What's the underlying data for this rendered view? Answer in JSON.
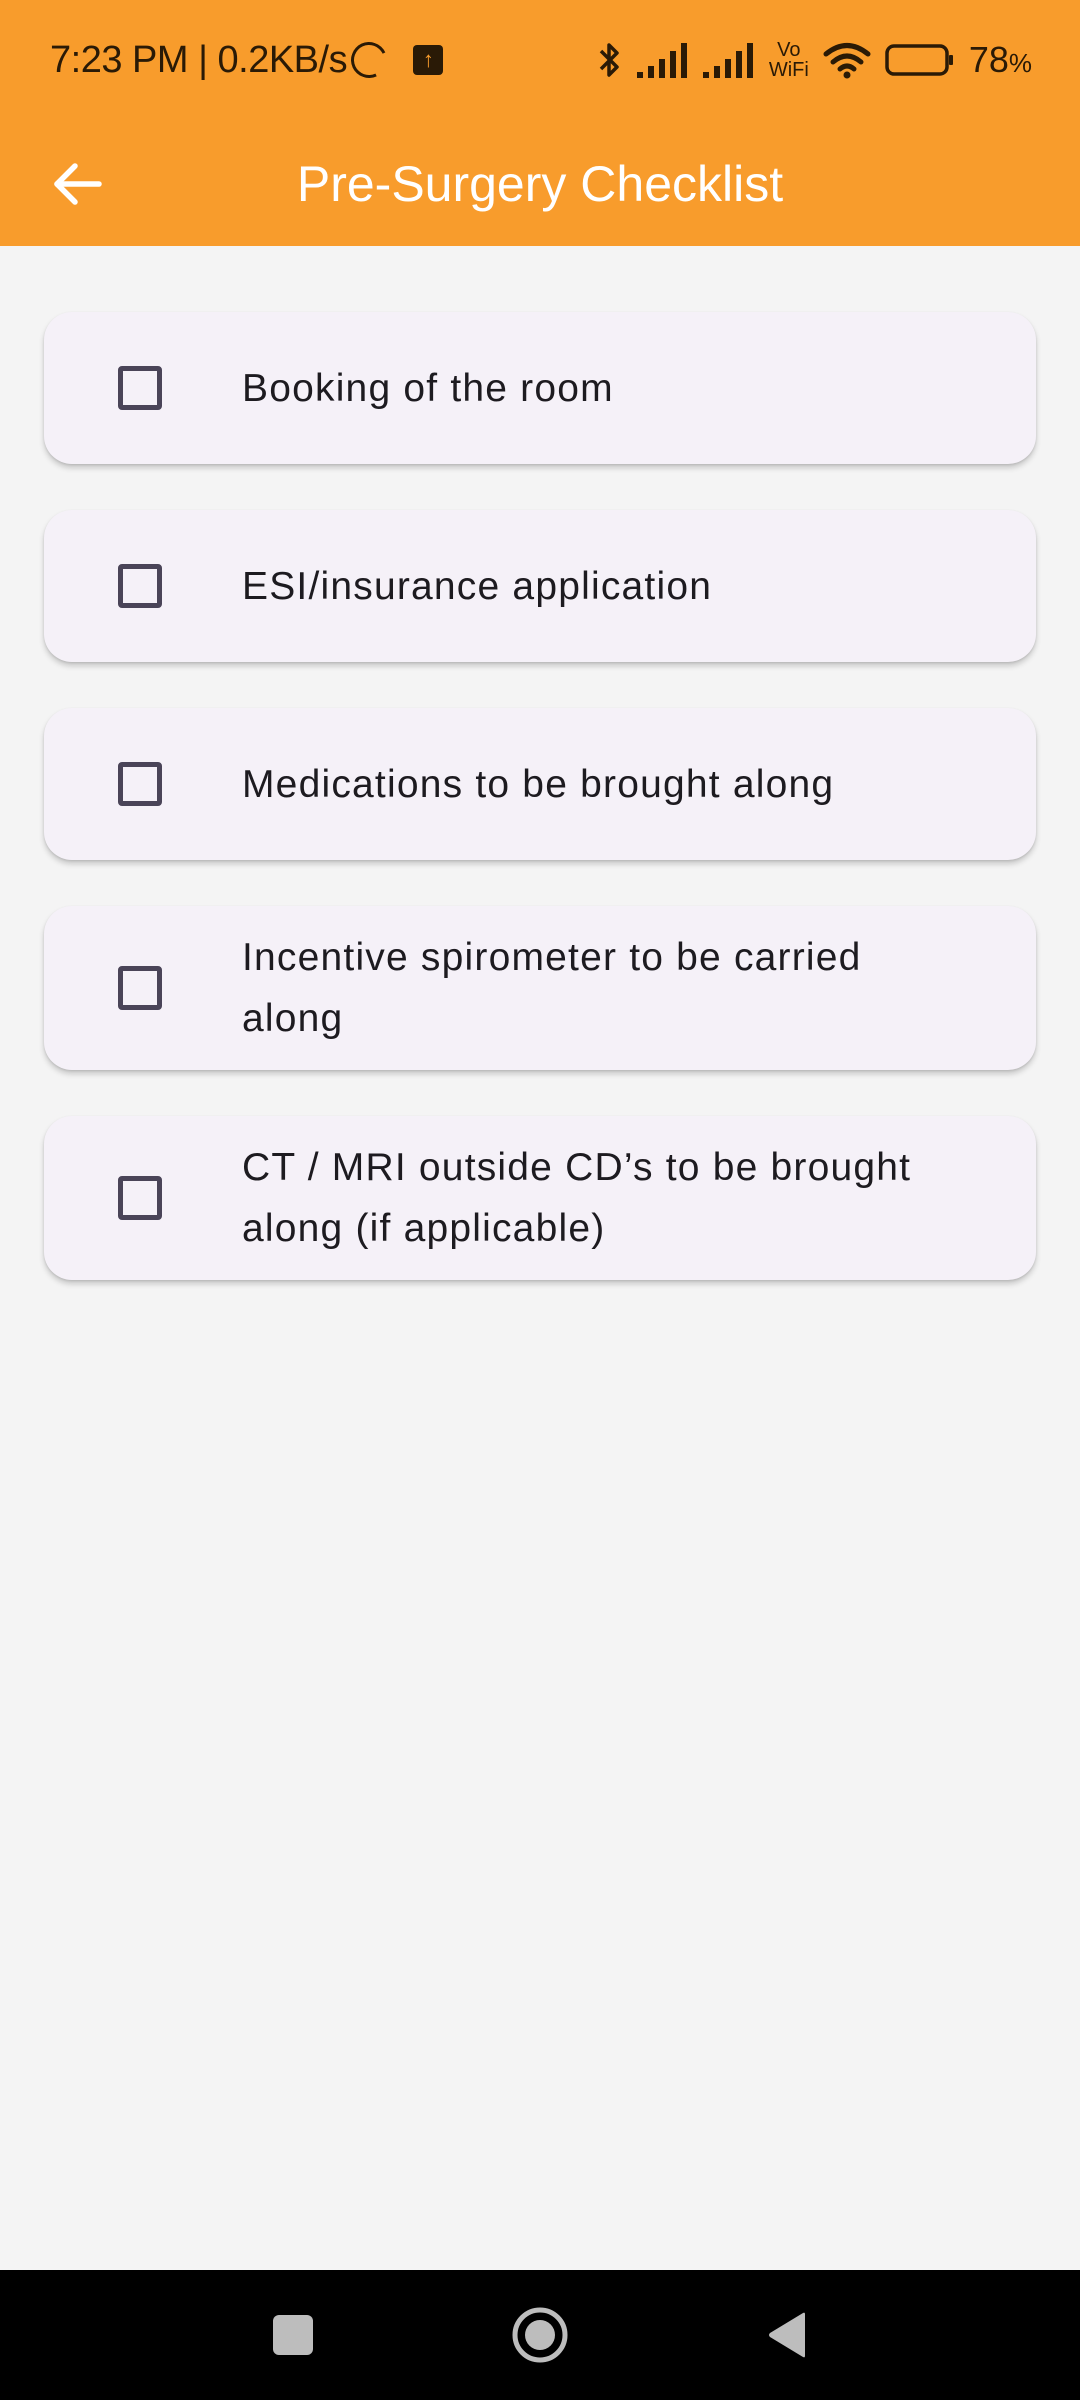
{
  "status_bar": {
    "time_speed": "7:23 PM | 0.2KB/s",
    "vowifi_top": "Vo",
    "vowifi_bottom": "WiFi",
    "battery": "78",
    "battery_unit": "%"
  },
  "app_bar": {
    "title": "Pre-Surgery Checklist",
    "back_icon": "arrow-left-icon"
  },
  "checklist": {
    "items": [
      {
        "label": "Booking of the room",
        "checked": false
      },
      {
        "label": "ESI/insurance application",
        "checked": false
      },
      {
        "label": "Medications to be brought along",
        "checked": false
      },
      {
        "label": "Incentive spirometer to be carried along",
        "checked": false
      },
      {
        "label": "CT / MRI outside CD’s to be brought along (if applicable)",
        "checked": false
      }
    ]
  },
  "nav_bar": {
    "recents_icon": "square-icon",
    "home_icon": "circle-icon",
    "back_icon": "triangle-back-icon"
  },
  "colors": {
    "accent": "#f89c2c",
    "card": "#f5f1f8",
    "background": "#f4f4f4"
  }
}
